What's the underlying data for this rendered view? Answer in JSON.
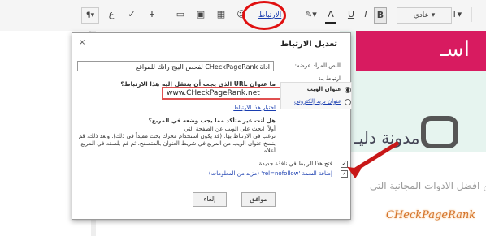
{
  "toolbar": {
    "font_select": "عادي",
    "link_label": "الارتباط",
    "bold": "B",
    "underline": "U",
    "italic": "I",
    "text_color": "A",
    "font_size": "T",
    "rtl": "¶"
  },
  "dialog": {
    "title": "تعديل الارتباط",
    "close": "×",
    "display_text_label": "النص المراد عرضه:",
    "display_text_value": "اداة CHeckPageRank لفحص البيج رانك للمواقع",
    "link_to_label": "ارتباط بـ:",
    "url_question": "ما عنوان URL الذي يجب أن ينتقل إليه هذا الارتباط؟",
    "url_value": "www.CHeckPageRank.net",
    "option_web": "عنوان الويب",
    "option_email": "عنوان بريد إلكتروني",
    "test_link": "اختبار هذا الارتباط",
    "help_title": "هل أنت غير متأكد مما يجب وضعه في المربع؟",
    "help_line1": "أولاً، ابحث على الويب عن الصفحة التي",
    "help_line2": "ترغب في الارتباط بها. (قد يكون استخدام محرك بحث مفيداً في ذلك). وبعد ذلك، قم",
    "help_line3": "بنسخ عنوان الويب من المربع في شريط العنوان بالمتصفح، ثم قم بلصقه في المربع",
    "help_line4": "أعلاه.",
    "checkbox_new_window": "فتح هذا الرابط في نافذة جديدة",
    "checkbox_nofollow": "إضافة السمة 'rel=nofollow' (مزيد من المعلومات)",
    "ok": "موافق",
    "cancel": "إلغاء"
  },
  "background": {
    "banner_top": "اسـ",
    "banner_mid": "مدونة دليـ",
    "editor_line1": "من افضل الادوات المجانية التي",
    "editor_line2": "CHeckPageRank"
  },
  "colors": {
    "accent_red": "#e01010",
    "link_blue": "#1a3eb0"
  }
}
